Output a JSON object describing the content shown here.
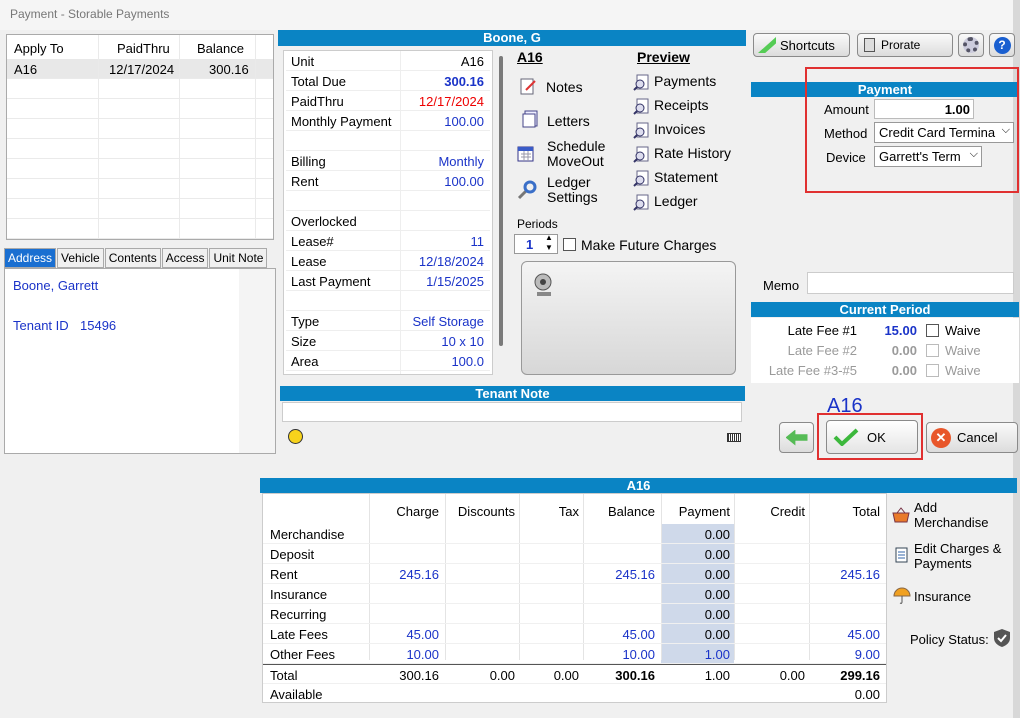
{
  "window": {
    "title": "Payment - Storable Payments"
  },
  "apply": {
    "headers": [
      "Apply To",
      "PaidThru",
      "Balance"
    ],
    "rows": [
      {
        "unit": "A16",
        "paid_thru": "12/17/2024",
        "balance": "300.16"
      }
    ]
  },
  "tabs": [
    "Address",
    "Vehicle",
    "Contents",
    "Access",
    "Unit Note"
  ],
  "address": {
    "name": "Boone, Garrett",
    "tenant_label": "Tenant ID",
    "tenant_id": "15496"
  },
  "tenant": {
    "name": "Boone, G"
  },
  "details": [
    {
      "label": "Unit",
      "value": "A16",
      "style": "black"
    },
    {
      "label": "Total Due",
      "value": "300.16",
      "style": "boldblue"
    },
    {
      "label": "PaidThru",
      "value": "12/17/2024",
      "style": "red"
    },
    {
      "label": "Monthly Payment",
      "value": "100.00",
      "style": "blue"
    },
    {
      "label": "",
      "value": "",
      "style": "blue"
    },
    {
      "label": "Billing",
      "value": "Monthly",
      "style": "blue"
    },
    {
      "label": "Rent",
      "value": "100.00",
      "style": "blue"
    },
    {
      "label": "",
      "value": "",
      "style": "blue"
    },
    {
      "label": "Overlocked",
      "value": "",
      "style": "blue"
    },
    {
      "label": "Lease#",
      "value": "11",
      "style": "blue"
    },
    {
      "label": "Lease",
      "value": "12/18/2024",
      "style": "blue"
    },
    {
      "label": "Last Payment",
      "value": "1/15/2025",
      "style": "blue"
    },
    {
      "label": "",
      "value": "",
      "style": "blue"
    },
    {
      "label": "Type",
      "value": "Self Storage",
      "style": "blue"
    },
    {
      "label": "Size",
      "value": "10 x 10",
      "style": "blue"
    },
    {
      "label": "Area",
      "value": "100.0",
      "style": "blue"
    }
  ],
  "actions": {
    "unit": "A16",
    "notes": "Notes",
    "letters": "Letters",
    "schedule_moveout": "Schedule MoveOut",
    "ledger_settings": "Ledger Settings"
  },
  "preview": {
    "title": "Preview",
    "items": [
      "Payments",
      "Receipts",
      "Invoices",
      "Rate History",
      "Statement",
      "Ledger"
    ]
  },
  "periods": {
    "label": "Periods",
    "value": "1",
    "future_charges": "Make Future Charges"
  },
  "tenant_note": {
    "title": "Tenant Note"
  },
  "toolbar": {
    "shortcuts": "Shortcuts",
    "prorate": "Prorate"
  },
  "payment": {
    "title": "Payment",
    "amount_label": "Amount",
    "amount": "1.00",
    "method_label": "Method",
    "method": "Credit Card Termina",
    "device_label": "Device",
    "device": "Garrett's Term"
  },
  "memo": {
    "label": "Memo"
  },
  "current_period": {
    "title": "Current Period",
    "rows": [
      {
        "label": "Late Fee #1",
        "value": "15.00",
        "waive": "Waive",
        "enabled": true
      },
      {
        "label": "Late Fee #2",
        "value": "0.00",
        "waive": "Waive",
        "enabled": false
      },
      {
        "label": "Late Fee #3-#5",
        "value": "0.00",
        "waive": "Waive",
        "enabled": false
      }
    ]
  },
  "ok_unit": "A16",
  "buttons": {
    "ok": "OK",
    "cancel": "Cancel"
  },
  "grid": {
    "title": "A16",
    "columns": [
      "Charge",
      "Discounts",
      "Tax",
      "Balance",
      "Payment",
      "Credit",
      "Total"
    ],
    "rows": [
      {
        "label": "Merchandise",
        "charge": "",
        "discounts": "",
        "tax": "",
        "balance": "",
        "payment": "0.00",
        "credit": "",
        "total": ""
      },
      {
        "label": "Deposit",
        "charge": "",
        "discounts": "",
        "tax": "",
        "balance": "",
        "payment": "0.00",
        "credit": "",
        "total": ""
      },
      {
        "label": "Rent",
        "charge": "245.16",
        "discounts": "",
        "tax": "",
        "balance": "245.16",
        "payment": "0.00",
        "credit": "",
        "total": "245.16"
      },
      {
        "label": "Insurance",
        "charge": "",
        "discounts": "",
        "tax": "",
        "balance": "",
        "payment": "0.00",
        "credit": "",
        "total": ""
      },
      {
        "label": "Recurring",
        "charge": "",
        "discounts": "",
        "tax": "",
        "balance": "",
        "payment": "0.00",
        "credit": "",
        "total": ""
      },
      {
        "label": "Late Fees",
        "charge": "45.00",
        "discounts": "",
        "tax": "",
        "balance": "45.00",
        "payment": "0.00",
        "credit": "",
        "total": "45.00"
      },
      {
        "label": "Other Fees",
        "charge": "10.00",
        "discounts": "",
        "tax": "",
        "balance": "10.00",
        "payment": "1.00",
        "credit": "",
        "total": "9.00"
      }
    ],
    "total": {
      "label": "Total",
      "charge": "300.16",
      "discounts": "0.00",
      "tax": "0.00",
      "balance": "300.16",
      "payment": "1.00",
      "credit": "0.00",
      "total": "299.16"
    },
    "available": {
      "label": "Available",
      "total": "0.00"
    }
  },
  "side_actions": {
    "add_merch": "Add Merchandise",
    "edit_charges": "Edit Charges & Payments",
    "insurance": "Insurance",
    "policy_status": "Policy Status:"
  }
}
